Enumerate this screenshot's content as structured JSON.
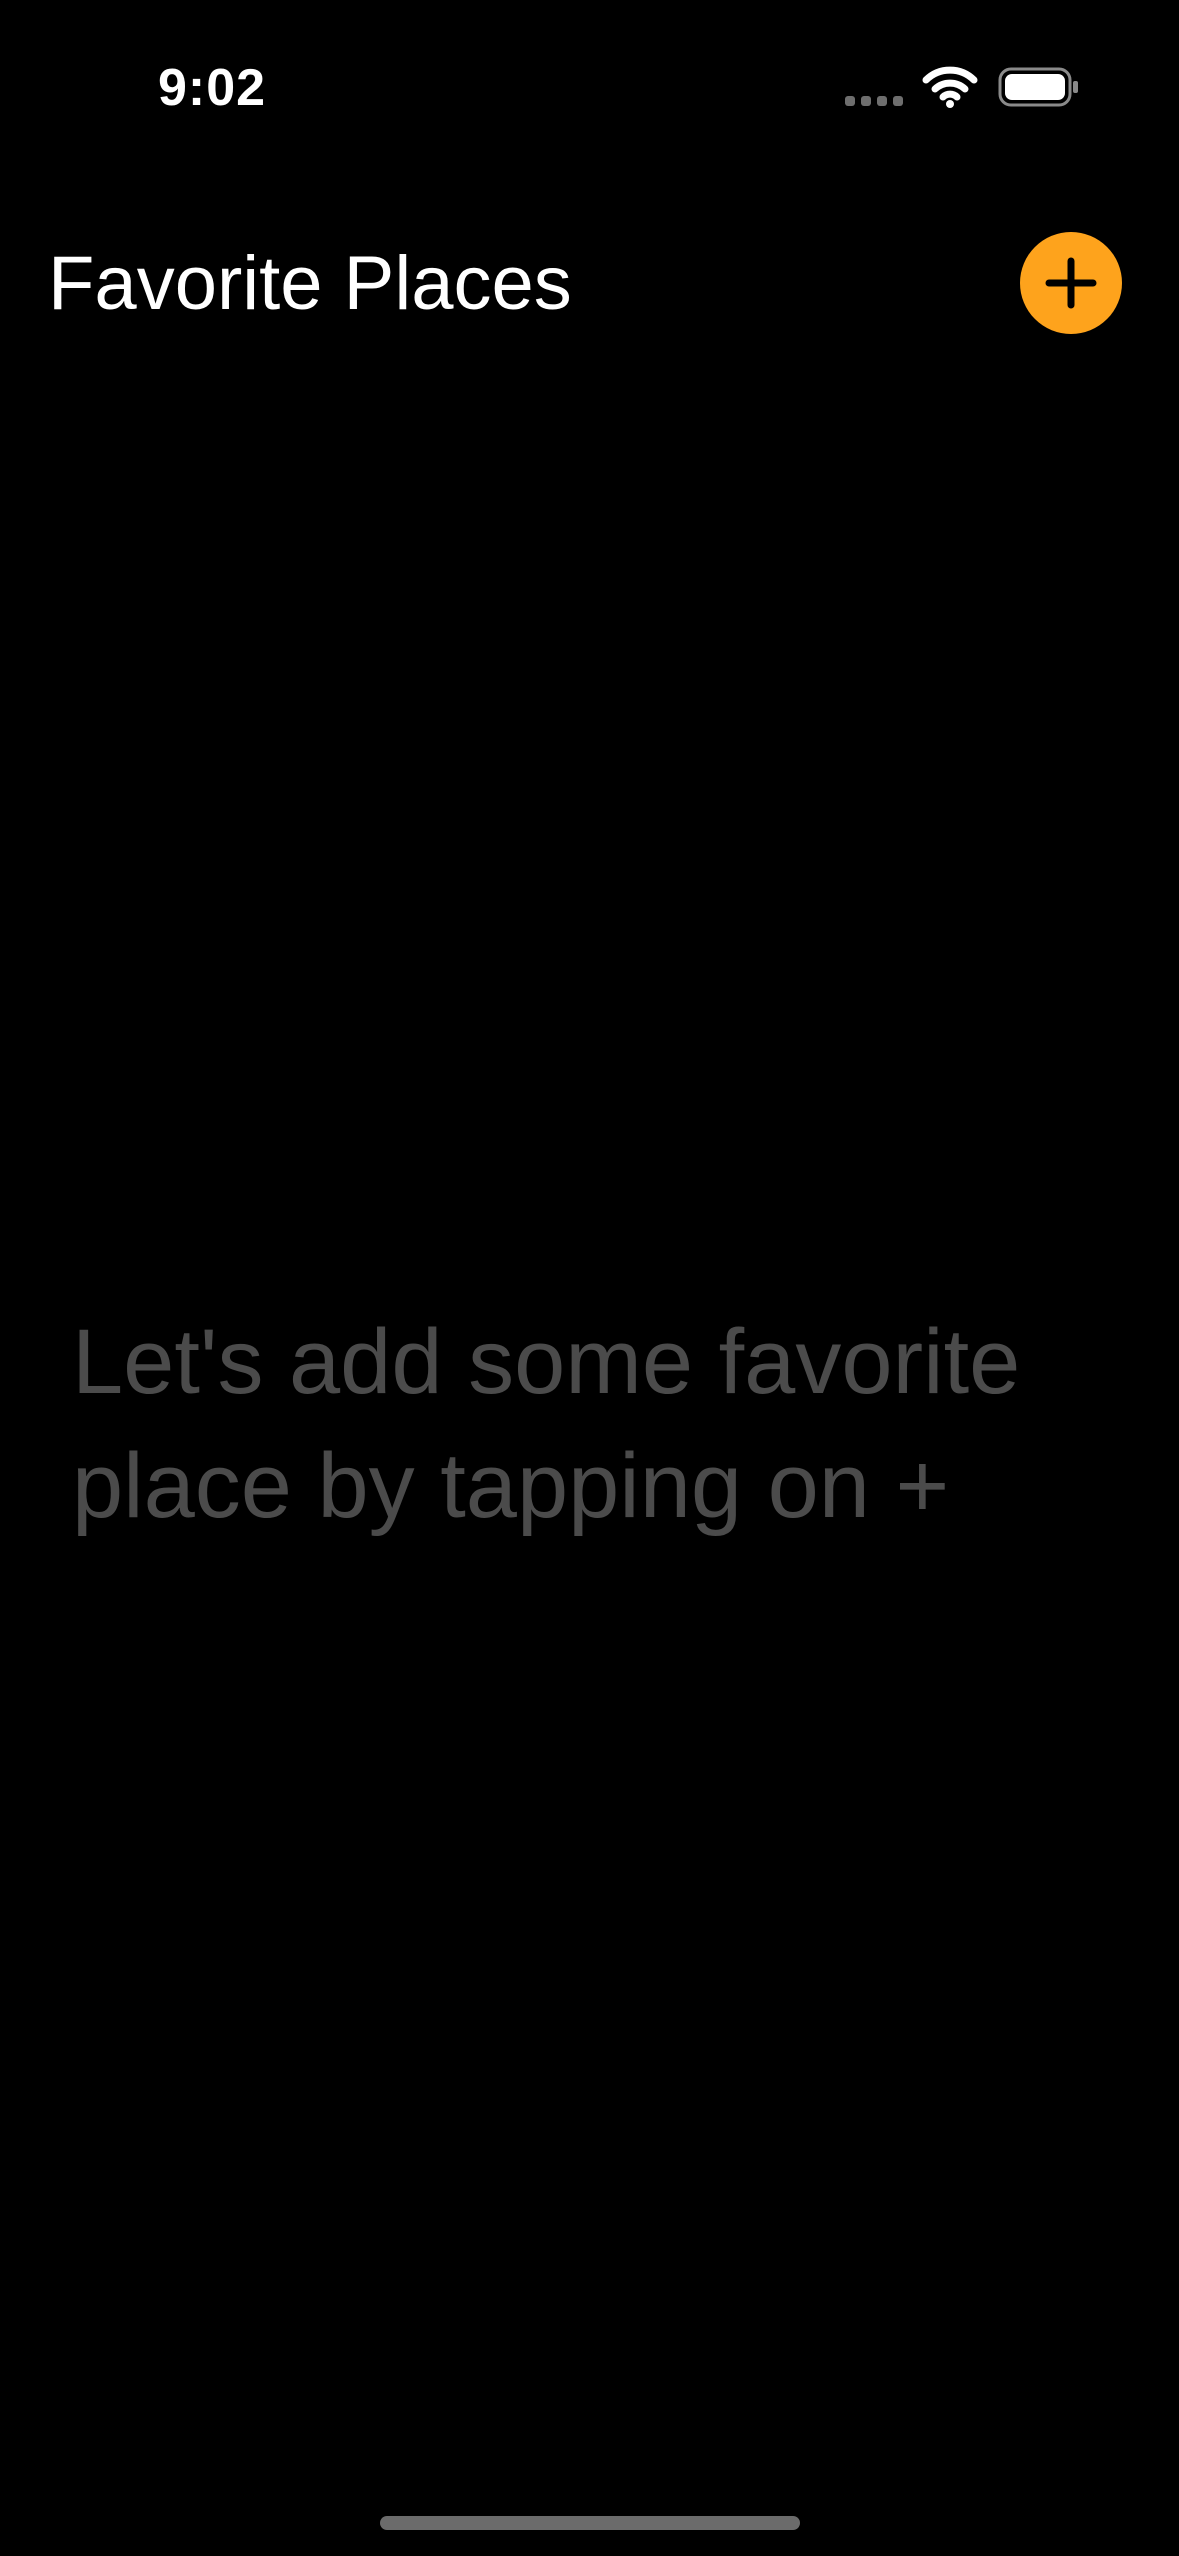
{
  "status_bar": {
    "time": "9:02",
    "icons": [
      "signal-dots-icon",
      "wifi-icon",
      "battery-icon"
    ]
  },
  "header": {
    "title": "Favorite Places",
    "add_button_icon": "plus-icon",
    "accent_color": "#fea31c"
  },
  "main": {
    "empty_message": "Let's add some favorite place by tapping on +"
  },
  "colors": {
    "background": "#000000",
    "title_text": "#ffffff",
    "empty_text": "#4b4b4b"
  }
}
